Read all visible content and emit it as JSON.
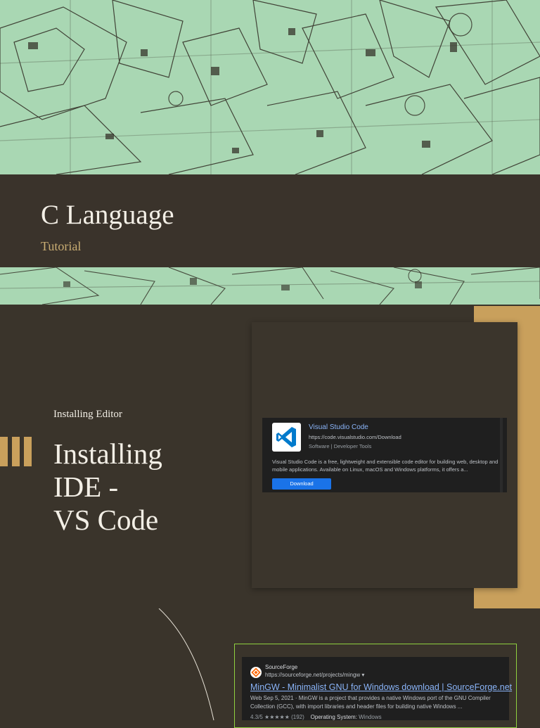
{
  "cover": {
    "title": "C Language",
    "subtitle": "Tutorial"
  },
  "slide": {
    "section_label": "Installing Editor",
    "heading_lines": [
      "Installing",
      "IDE -",
      "VS Code"
    ]
  },
  "vscode_result": {
    "title": "Visual Studio Code",
    "url": "https://code.visualstudio.com/Download",
    "tags": "Software  |  Developer Tools",
    "description": "Visual Studio Code is a free, lightweight and extensible code editor for building web, desktop and mobile applications. Available on Linux, macOS and Windows platforms, it offers a...",
    "download_label": "Download",
    "logo_icon": "vscode-icon"
  },
  "sourceforge_result": {
    "site_name": "SourceForge",
    "url": "https://sourceforge.net/projects/mingw ▾",
    "title": "MinGW - Minimalist GNU for Windows download | SourceForge.net",
    "description": "Web Sep 5, 2021 · MinGW is a project that provides a native Windows port of the GNU Compiler Collection (GCC), with import libraries and header files for building native Windows ...",
    "rating": "4.3/5 ★★★★★ (192)",
    "os_label": "Operating System:",
    "os_value": "Windows",
    "site_icon": "sourceforge-icon"
  },
  "colors": {
    "accent_gold": "#c9a05c",
    "background": "#3a342b",
    "band_green": "#a9d7b3",
    "link_blue": "#8ab4f8",
    "frame_green": "#8fd13f"
  }
}
